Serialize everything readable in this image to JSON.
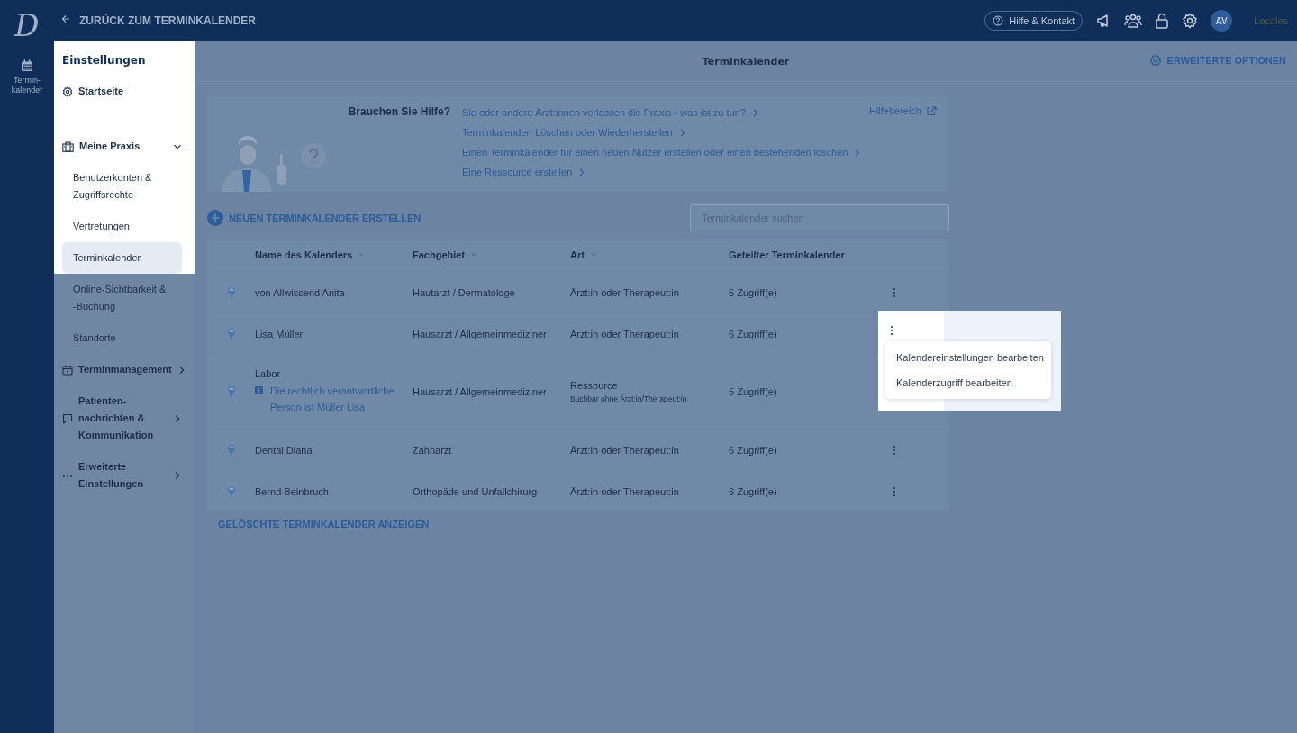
{
  "topbar": {
    "back_label": "ZURÜCK ZUM TERMINKALENDER",
    "help_button": "Hilfe & Kontakt",
    "avatar": "AV",
    "locale": "Locales"
  },
  "rail": {
    "logo": "D",
    "items": [
      {
        "label": "Termin-kalender"
      }
    ]
  },
  "sidebar": {
    "title": "Einstellungen",
    "items": [
      {
        "label": "Startseite",
        "highlighted": true
      },
      {
        "label": "Meine Praxis",
        "highlighted": true,
        "expanded": true,
        "children": [
          {
            "label": "Benutzerkonten & Zugriffsrechte",
            "selected": false,
            "highlighted": true
          },
          {
            "label": "Vertretungen",
            "selected": false,
            "highlighted": true
          },
          {
            "label": "Terminkalender",
            "selected": true,
            "highlighted": true
          },
          {
            "label": "Online-Sichtbarkeit & -Buchung",
            "selected": false,
            "highlighted": false
          },
          {
            "label": "Standorte",
            "selected": false,
            "highlighted": false
          }
        ]
      },
      {
        "label": "Terminmanagement",
        "highlighted": false,
        "expanded": false
      },
      {
        "label": "Patienten-nachrichten & Kommunikation",
        "highlighted": false,
        "expanded": false
      },
      {
        "label": "Erweiterte Einstellungen",
        "highlighted": false,
        "expanded": false
      }
    ]
  },
  "header": {
    "title": "Terminkalender",
    "options_link": "ERWEITERTE OPTIONEN"
  },
  "help": {
    "heading": "Brauchen Sie Hilfe?",
    "links": [
      "Sie oder andere Ärzt:innen verlassen die Praxis - was ist zu tun?",
      "Terminkalender: Löschen oder Wiederherstellen",
      "Einen Terminkalender für einen neuen Nutzer erstellen oder einen bestehenden löschen",
      "Eine Ressource erstellen"
    ],
    "help_area": "Hilfebereich"
  },
  "create_button": "NEUEN TERMINKALENDER ERSTELLEN",
  "search": {
    "placeholder": "Terminkalender suchen"
  },
  "table": {
    "columns": [
      {
        "label": "Name des Kalenders",
        "sortable": true
      },
      {
        "label": "Fachgebiet",
        "sortable": true
      },
      {
        "label": "Art",
        "sortable": true
      },
      {
        "label": "Geteilter Terminkalender",
        "sortable": false
      }
    ],
    "rows": [
      {
        "name": "von Allwissend Anita",
        "specialty": "Hautarzt / Dermatologe",
        "type": "Ärzt:in oder Therapeut:in",
        "access": "5 Zugriff(e)",
        "menu_open": false
      },
      {
        "name": "Lisa Müller",
        "specialty": "Hausarzt / Allgemeinmediziner",
        "type": "Ärzt:in oder Therapeut:in",
        "access": "6 Zugriff(e)",
        "menu_open": true
      },
      {
        "name": "Labor",
        "note": "Die rechtlich verantwortliche Person ist Müller Lisa",
        "specialty": "Hausarzt / Allgemeinmediziner",
        "type": "Ressource",
        "type_note": "Buchbar ohne Ärzt:in/Therapeut:in",
        "access": "5 Zugriff(e)",
        "menu_open": false
      },
      {
        "name": "Dental Diana",
        "specialty": "Zahnarzt",
        "type": "Ärzt:in oder Therapeut:in",
        "access": "6 Zugriff(e)",
        "menu_open": false
      },
      {
        "name": "Bernd Beinbruch",
        "specialty": "Orthopäde und Unfallchirurg",
        "type": "Ärzt:in oder Therapeut:in",
        "access": "6 Zugriff(e)",
        "menu_open": false
      }
    ],
    "row_menu": [
      "Kalendereinstellungen bearbeiten",
      "Kalenderzugriff bearbeiten"
    ]
  },
  "deleted_link": "GELÖSCHTE TERMINKALENDER ANZEIGEN"
}
